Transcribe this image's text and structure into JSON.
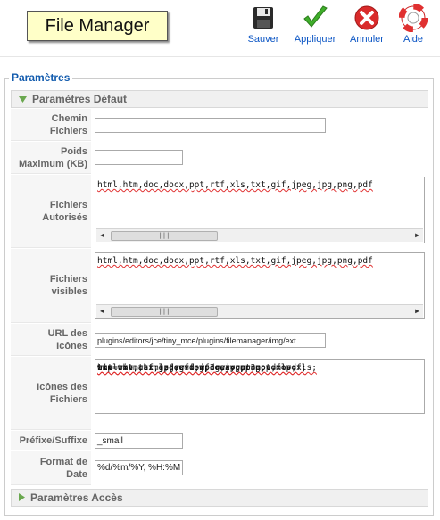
{
  "header": {
    "title": "File Manager",
    "buttons": [
      {
        "label": "Sauver",
        "icon": "floppy-disk-icon"
      },
      {
        "label": "Appliquer",
        "icon": "checkmark-icon"
      },
      {
        "label": "Annuler",
        "icon": "cancel-icon"
      },
      {
        "label": "Aide",
        "icon": "lifebuoy-icon"
      }
    ]
  },
  "fieldset": {
    "legend": "Paramètres",
    "panel_default": "Paramètres Défaut",
    "panel_access": "Paramètres Accès"
  },
  "fields": {
    "chemin": {
      "label1": "Chemin",
      "label2": "Fichiers",
      "value": ""
    },
    "poids": {
      "label1": "Poids",
      "label2": "Maximum (KB)",
      "value": ""
    },
    "autorises": {
      "label1": "Fichiers",
      "label2": "Autorisés",
      "value": "html,htm,doc,docx,ppt,rtf,xls,txt,gif,jpeg,jpg,png,pdf"
    },
    "visibles": {
      "label1": "Fichiers",
      "label2": "visibles",
      "value": "html,htm,doc,docx,ppt,rtf,xls,txt,gif,jpeg,jpg,png,pdf"
    },
    "url": {
      "label1": "URL des",
      "label2": "Icônes",
      "value": "plugins/editors/jce/tiny_mce/plugins/filemanager/img/ext"
    },
    "icones": {
      "label1": "Icônes des",
      "label2": "Fichiers",
      "lines": [
        "html=htm,html;doc=doc,docx;ppt=ppt,xls=xls;",
        "txt=txt,rtf;jpg=gif,jpeg,jpg,png;pdf=pdf;",
        "zip=zip,tar,gz;swf=swf;rar=rar;mov=mov;",
        "wmv=wmv,asx,asf,avi;mp3=wav,mp3"
      ]
    },
    "prefixe": {
      "label1": "Préfixe/Suffixe",
      "value": "_small"
    },
    "date": {
      "label1": "Format de",
      "label2": "Date",
      "value": "%d/%m/%Y, %H:%M"
    }
  },
  "colors": {
    "accent": "#135cae",
    "link": "#0b55c4",
    "title_bg": "#ffffc8"
  }
}
